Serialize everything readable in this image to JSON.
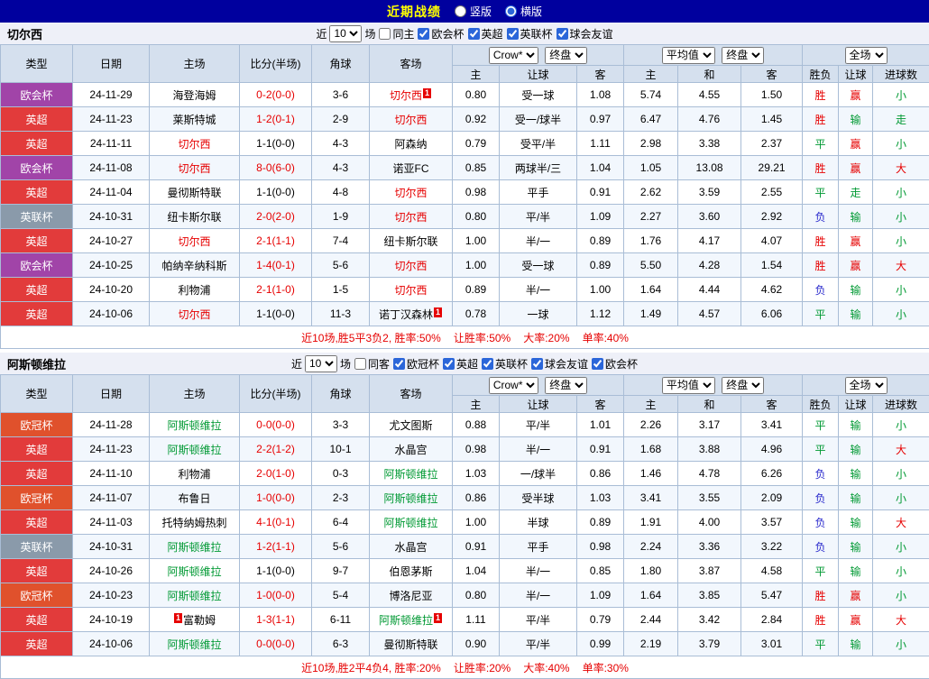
{
  "topbar": {
    "title": "近期战绩",
    "radios": [
      {
        "label": "竖版",
        "selected": false
      },
      {
        "label": "横版",
        "selected": true
      }
    ]
  },
  "labels": {
    "near": "近",
    "matches": "场"
  },
  "table_header": {
    "type": "类型",
    "date": "日期",
    "home": "主场",
    "score": "比分(半场)",
    "corner": "角球",
    "away": "客场",
    "odds_source": "Crow*",
    "odds_stage": "终盘",
    "avg_source": "平均值",
    "avg_stage": "终盘",
    "result_scope": "全场",
    "o_home": "主",
    "o_handicap": "让球",
    "o_away": "客",
    "a_home": "主",
    "a_draw": "和",
    "a_away": "客",
    "r_result": "胜负",
    "r_handicap": "让球",
    "r_goals": "进球数"
  },
  "colors": {
    "topbar_bg": "#00009e",
    "title_yellow": "#ffff00",
    "win_red": "#e60000",
    "draw_green": "#009933",
    "lose_blue": "#2828cc",
    "league_premier": "#e23b3b",
    "league_conference": "#a144a8",
    "league_efl_cup": "#8a9aaa",
    "league_champions": "#e0512c",
    "header_bg": "#d5e0ee",
    "border": "#a9bdd6"
  },
  "sections": [
    {
      "team": "切尔西",
      "filter": {
        "count": "10",
        "same_label": "同主",
        "same_checked": false,
        "leagues": [
          {
            "label": "欧会杯",
            "checked": true
          },
          {
            "label": "英超",
            "checked": true
          },
          {
            "label": "英联杯",
            "checked": true
          },
          {
            "label": "球会友谊",
            "checked": true
          }
        ]
      },
      "rows": [
        {
          "lg": "欧会杯",
          "lgc": "lg-purple",
          "date": "24-11-29",
          "home": "海登海姆",
          "score": "0-2(0-0)",
          "scorec": "t-red",
          "corner": "3-6",
          "away": "切尔西",
          "awayc": "t-red",
          "awaySup": "1",
          "o1": "0.80",
          "hc": "受一球",
          "o2": "1.08",
          "m1": "5.74",
          "m2": "4.55",
          "m3": "1.50",
          "r1": "胜",
          "r1c": "t-red",
          "r2": "赢",
          "r2c": "t-red",
          "r3": "小",
          "r3c": "t-green"
        },
        {
          "lg": "英超",
          "lgc": "lg-red",
          "date": "24-11-23",
          "home": "莱斯特城",
          "score": "1-2(0-1)",
          "scorec": "t-red",
          "corner": "2-9",
          "away": "切尔西",
          "awayc": "t-red",
          "o1": "0.92",
          "hc": "受一/球半",
          "o2": "0.97",
          "m1": "6.47",
          "m2": "4.76",
          "m3": "1.45",
          "r1": "胜",
          "r1c": "t-red",
          "r2": "输",
          "r2c": "t-green",
          "r3": "走",
          "r3c": "t-green"
        },
        {
          "lg": "英超",
          "lgc": "lg-red",
          "date": "24-11-11",
          "home": "切尔西",
          "homec": "t-red",
          "score": "1-1(0-0)",
          "corner": "4-3",
          "away": "阿森纳",
          "o1": "0.79",
          "hc": "受平/半",
          "o2": "1.11",
          "m1": "2.98",
          "m2": "3.38",
          "m3": "2.37",
          "r1": "平",
          "r1c": "t-green",
          "r2": "赢",
          "r2c": "t-red",
          "r3": "小",
          "r3c": "t-green"
        },
        {
          "lg": "欧会杯",
          "lgc": "lg-purple",
          "date": "24-11-08",
          "home": "切尔西",
          "homec": "t-red",
          "score": "8-0(6-0)",
          "scorec": "t-red",
          "corner": "4-3",
          "away": "诺亚FC",
          "o1": "0.85",
          "hc": "两球半/三",
          "o2": "1.04",
          "m1": "1.05",
          "m2": "13.08",
          "m3": "29.21",
          "r1": "胜",
          "r1c": "t-red",
          "r2": "赢",
          "r2c": "t-red",
          "r3": "大",
          "r3c": "t-red"
        },
        {
          "lg": "英超",
          "lgc": "lg-red",
          "date": "24-11-04",
          "home": "曼彻斯特联",
          "score": "1-1(0-0)",
          "corner": "4-8",
          "away": "切尔西",
          "awayc": "t-red",
          "o1": "0.98",
          "hc": "平手",
          "o2": "0.91",
          "m1": "2.62",
          "m2": "3.59",
          "m3": "2.55",
          "r1": "平",
          "r1c": "t-green",
          "r2": "走",
          "r2c": "t-green",
          "r3": "小",
          "r3c": "t-green"
        },
        {
          "lg": "英联杯",
          "lgc": "lg-gray",
          "date": "24-10-31",
          "home": "纽卡斯尔联",
          "score": "2-0(2-0)",
          "scorec": "t-red",
          "corner": "1-9",
          "away": "切尔西",
          "awayc": "t-red",
          "o1": "0.80",
          "hc": "平/半",
          "o2": "1.09",
          "m1": "2.27",
          "m2": "3.60",
          "m3": "2.92",
          "r1": "负",
          "r1c": "t-blue",
          "r2": "输",
          "r2c": "t-green",
          "r3": "小",
          "r3c": "t-green"
        },
        {
          "lg": "英超",
          "lgc": "lg-red",
          "date": "24-10-27",
          "home": "切尔西",
          "homec": "t-red",
          "score": "2-1(1-1)",
          "scorec": "t-red",
          "corner": "7-4",
          "away": "纽卡斯尔联",
          "o1": "1.00",
          "hc": "半/一",
          "o2": "0.89",
          "m1": "1.76",
          "m2": "4.17",
          "m3": "4.07",
          "r1": "胜",
          "r1c": "t-red",
          "r2": "赢",
          "r2c": "t-red",
          "r3": "小",
          "r3c": "t-green"
        },
        {
          "lg": "欧会杯",
          "lgc": "lg-purple",
          "date": "24-10-25",
          "home": "帕纳辛纳科斯",
          "score": "1-4(0-1)",
          "scorec": "t-red",
          "corner": "5-6",
          "away": "切尔西",
          "awayc": "t-red",
          "o1": "1.00",
          "hc": "受一球",
          "o2": "0.89",
          "m1": "5.50",
          "m2": "4.28",
          "m3": "1.54",
          "r1": "胜",
          "r1c": "t-red",
          "r2": "赢",
          "r2c": "t-red",
          "r3": "大",
          "r3c": "t-red"
        },
        {
          "lg": "英超",
          "lgc": "lg-red",
          "date": "24-10-20",
          "home": "利物浦",
          "score": "2-1(1-0)",
          "scorec": "t-red",
          "corner": "1-5",
          "away": "切尔西",
          "awayc": "t-red",
          "o1": "0.89",
          "hc": "半/一",
          "o2": "1.00",
          "m1": "1.64",
          "m2": "4.44",
          "m3": "4.62",
          "r1": "负",
          "r1c": "t-blue",
          "r2": "输",
          "r2c": "t-green",
          "r3": "小",
          "r3c": "t-green"
        },
        {
          "lg": "英超",
          "lgc": "lg-red",
          "date": "24-10-06",
          "home": "切尔西",
          "homec": "t-red",
          "score": "1-1(0-0)",
          "corner": "11-3",
          "away": "诺丁汉森林",
          "awaySup": "1",
          "o1": "0.78",
          "hc": "一球",
          "o2": "1.12",
          "m1": "1.49",
          "m2": "4.57",
          "m3": "6.06",
          "r1": "平",
          "r1c": "t-green",
          "r2": "输",
          "r2c": "t-green",
          "r3": "小",
          "r3c": "t-green"
        }
      ],
      "summary": [
        "近10场,胜5平3负2, 胜率:50%",
        "让胜率:50%",
        "大率:20%",
        "单率:40%"
      ]
    },
    {
      "team": "阿斯顿维拉",
      "filter": {
        "count": "10",
        "same_label": "同客",
        "same_checked": false,
        "leagues": [
          {
            "label": "欧冠杯",
            "checked": true
          },
          {
            "label": "英超",
            "checked": true
          },
          {
            "label": "英联杯",
            "checked": true
          },
          {
            "label": "球会友谊",
            "checked": true
          },
          {
            "label": "欧会杯",
            "checked": true
          }
        ]
      },
      "rows": [
        {
          "lg": "欧冠杯",
          "lgc": "lg-orange",
          "date": "24-11-28",
          "home": "阿斯顿维拉",
          "homec": "t-green",
          "score": "0-0(0-0)",
          "scorec": "t-red",
          "corner": "3-3",
          "away": "尤文图斯",
          "o1": "0.88",
          "hc": "平/半",
          "o2": "1.01",
          "m1": "2.26",
          "m2": "3.17",
          "m3": "3.41",
          "r1": "平",
          "r1c": "t-green",
          "r2": "输",
          "r2c": "t-green",
          "r3": "小",
          "r3c": "t-green"
        },
        {
          "lg": "英超",
          "lgc": "lg-red",
          "date": "24-11-23",
          "home": "阿斯顿维拉",
          "homec": "t-green",
          "score": "2-2(1-2)",
          "scorec": "t-red",
          "corner": "10-1",
          "away": "水晶宫",
          "o1": "0.98",
          "hc": "半/一",
          "o2": "0.91",
          "m1": "1.68",
          "m2": "3.88",
          "m3": "4.96",
          "r1": "平",
          "r1c": "t-green",
          "r2": "输",
          "r2c": "t-green",
          "r3": "大",
          "r3c": "t-red"
        },
        {
          "lg": "英超",
          "lgc": "lg-red",
          "date": "24-11-10",
          "home": "利物浦",
          "score": "2-0(1-0)",
          "scorec": "t-red",
          "corner": "0-3",
          "away": "阿斯顿维拉",
          "awayc": "t-green",
          "o1": "1.03",
          "hc": "一/球半",
          "o2": "0.86",
          "m1": "1.46",
          "m2": "4.78",
          "m3": "6.26",
          "r1": "负",
          "r1c": "t-blue",
          "r2": "输",
          "r2c": "t-green",
          "r3": "小",
          "r3c": "t-green"
        },
        {
          "lg": "欧冠杯",
          "lgc": "lg-orange",
          "date": "24-11-07",
          "home": "布鲁日",
          "score": "1-0(0-0)",
          "scorec": "t-red",
          "corner": "2-3",
          "away": "阿斯顿维拉",
          "awayc": "t-green",
          "o1": "0.86",
          "hc": "受半球",
          "o2": "1.03",
          "m1": "3.41",
          "m2": "3.55",
          "m3": "2.09",
          "r1": "负",
          "r1c": "t-blue",
          "r2": "输",
          "r2c": "t-green",
          "r3": "小",
          "r3c": "t-green"
        },
        {
          "lg": "英超",
          "lgc": "lg-red",
          "date": "24-11-03",
          "home": "托特纳姆热刺",
          "score": "4-1(0-1)",
          "scorec": "t-red",
          "corner": "6-4",
          "away": "阿斯顿维拉",
          "awayc": "t-green",
          "o1": "1.00",
          "hc": "半球",
          "o2": "0.89",
          "m1": "1.91",
          "m2": "4.00",
          "m3": "3.57",
          "r1": "负",
          "r1c": "t-blue",
          "r2": "输",
          "r2c": "t-green",
          "r3": "大",
          "r3c": "t-red"
        },
        {
          "lg": "英联杯",
          "lgc": "lg-gray",
          "date": "24-10-31",
          "home": "阿斯顿维拉",
          "homec": "t-green",
          "score": "1-2(1-1)",
          "scorec": "t-red",
          "corner": "5-6",
          "away": "水晶宫",
          "o1": "0.91",
          "hc": "平手",
          "o2": "0.98",
          "m1": "2.24",
          "m2": "3.36",
          "m3": "3.22",
          "r1": "负",
          "r1c": "t-blue",
          "r2": "输",
          "r2c": "t-green",
          "r3": "小",
          "r3c": "t-green"
        },
        {
          "lg": "英超",
          "lgc": "lg-red",
          "date": "24-10-26",
          "home": "阿斯顿维拉",
          "homec": "t-green",
          "score": "1-1(0-0)",
          "corner": "9-7",
          "away": "伯恩茅斯",
          "o1": "1.04",
          "hc": "半/一",
          "o2": "0.85",
          "m1": "1.80",
          "m2": "3.87",
          "m3": "4.58",
          "r1": "平",
          "r1c": "t-green",
          "r2": "输",
          "r2c": "t-green",
          "r3": "小",
          "r3c": "t-green"
        },
        {
          "lg": "欧冠杯",
          "lgc": "lg-orange",
          "date": "24-10-23",
          "home": "阿斯顿维拉",
          "homec": "t-green",
          "score": "1-0(0-0)",
          "scorec": "t-red",
          "corner": "5-4",
          "away": "博洛尼亚",
          "o1": "0.80",
          "hc": "半/一",
          "o2": "1.09",
          "m1": "1.64",
          "m2": "3.85",
          "m3": "5.47",
          "r1": "胜",
          "r1c": "t-red",
          "r2": "赢",
          "r2c": "t-red",
          "r3": "小",
          "r3c": "t-green"
        },
        {
          "lg": "英超",
          "lgc": "lg-red",
          "date": "24-10-19",
          "home": "富勒姆",
          "homePre": "1",
          "score": "1-3(1-1)",
          "scorec": "t-red",
          "corner": "6-11",
          "away": "阿斯顿维拉",
          "awayc": "t-green",
          "awaySup": "1",
          "o1": "1.11",
          "hc": "平/半",
          "o2": "0.79",
          "m1": "2.44",
          "m2": "3.42",
          "m3": "2.84",
          "r1": "胜",
          "r1c": "t-red",
          "r2": "赢",
          "r2c": "t-red",
          "r3": "大",
          "r3c": "t-red"
        },
        {
          "lg": "英超",
          "lgc": "lg-red",
          "date": "24-10-06",
          "home": "阿斯顿维拉",
          "homec": "t-green",
          "score": "0-0(0-0)",
          "scorec": "t-red",
          "corner": "6-3",
          "away": "曼彻斯特联",
          "o1": "0.90",
          "hc": "平/半",
          "o2": "0.99",
          "m1": "2.19",
          "m2": "3.79",
          "m3": "3.01",
          "r1": "平",
          "r1c": "t-green",
          "r2": "输",
          "r2c": "t-green",
          "r3": "小",
          "r3c": "t-green"
        }
      ],
      "summary": [
        "近10场,胜2平4负4, 胜率:20%",
        "让胜率:20%",
        "大率:40%",
        "单率:30%"
      ]
    }
  ]
}
